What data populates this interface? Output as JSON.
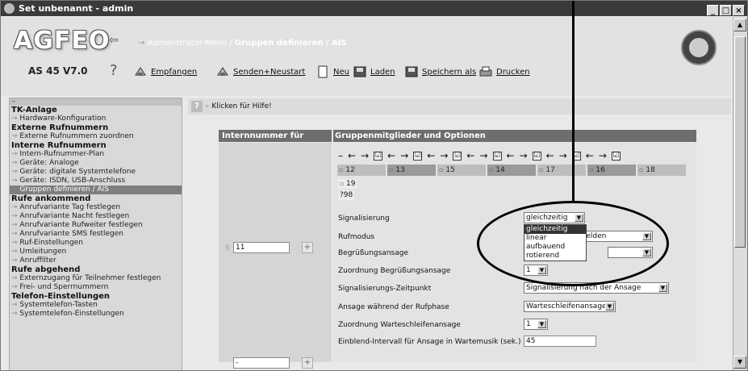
{
  "window": {
    "title": "Set unbenannt - admin",
    "controls": [
      "_",
      "□",
      "×"
    ]
  },
  "header": {
    "logo": "AGFEO",
    "breadcrumb_root": "Administrator-Menü",
    "breadcrumb_current": "Gruppen definieren / AIS",
    "version": "AS 45 V7.0",
    "help_mark": "?",
    "toolbar": [
      {
        "label": "Empfangen",
        "icon": "receive-icon"
      },
      {
        "label": "Senden+Neustart",
        "icon": "send-restart-icon"
      },
      {
        "label": "Neu",
        "icon": "new-document-icon"
      },
      {
        "label": "Laden",
        "icon": "load-icon"
      },
      {
        "label": "Speichern als",
        "icon": "save-as-icon"
      },
      {
        "label": "Drucken",
        "icon": "print-icon"
      }
    ]
  },
  "sidebar": {
    "collapse": "–",
    "items": [
      {
        "type": "section",
        "label": "TK-Anlage"
      },
      {
        "type": "item",
        "label": "Hardware-Konfiguration"
      },
      {
        "type": "section",
        "label": "Externe Rufnummern"
      },
      {
        "type": "item",
        "label": "Externe Rufnummern zuordnen"
      },
      {
        "type": "section",
        "label": "Interne Rufnummern"
      },
      {
        "type": "item",
        "label": "Intern-Rufnummer-Plan"
      },
      {
        "type": "item",
        "label": "Geräte: Analoge"
      },
      {
        "type": "item",
        "label": "Geräte: digitale Systemtelefone"
      },
      {
        "type": "item",
        "label": "Geräte: ISDN, USB-Anschluss"
      },
      {
        "type": "selected",
        "label": "Gruppen definieren / AIS"
      },
      {
        "type": "section",
        "label": "Rufe ankommend"
      },
      {
        "type": "item",
        "label": "Anrufvariante Tag festlegen"
      },
      {
        "type": "item",
        "label": "Anrufvariante Nacht festlegen"
      },
      {
        "type": "item",
        "label": "Anrufvariante Rufweiter festlegen"
      },
      {
        "type": "item",
        "label": "Anrufvariante SMS festlegen"
      },
      {
        "type": "item",
        "label": "Ruf-Einstellungen"
      },
      {
        "type": "item",
        "label": "Umleitungen"
      },
      {
        "type": "item",
        "label": "Anruffilter"
      },
      {
        "type": "section",
        "label": "Rufe abgehend"
      },
      {
        "type": "item",
        "label": "Externzugang für Teilnehmer festlegen"
      },
      {
        "type": "item",
        "label": "Frei- und Sperrnummern"
      },
      {
        "type": "section",
        "label": "Telefon-Einstellungen"
      },
      {
        "type": "item",
        "label": "Systemtelefon-Tasten"
      },
      {
        "type": "item",
        "label": "Systemtelefon-Einstellungen"
      }
    ]
  },
  "help": {
    "icon": "?",
    "text": "Klicken für Hilfe!"
  },
  "table": {
    "col1_header": "Internnummer für Gruppe",
    "col2_header": "Gruppenmitglieder und Optionen",
    "group_number": "11",
    "group_number_next": "-",
    "plus": "+",
    "arrow_controls": [
      "–",
      "←",
      "→",
      "☑",
      "←",
      "→",
      "☑",
      "←",
      "→",
      "☑",
      "←",
      "→",
      "☑",
      "←",
      "→",
      "☑",
      "←",
      "→",
      "☑",
      "←",
      "→",
      "☑"
    ],
    "members": [
      "12",
      "13",
      "15",
      "14",
      "17",
      "16",
      "18"
    ],
    "extra_members": [
      "19",
      "?98"
    ],
    "options": {
      "signalisierung": {
        "label": "Signalisierung",
        "value": "gleichzeitig"
      },
      "rufmodus": {
        "label": "Rufmodus",
        "value": "r Melden"
      },
      "begruessungsansage": {
        "label": "Begrüßungsansage",
        "value": ""
      },
      "zuordnung_begruessung": {
        "label": "Zuordnung Begrüßungsansage",
        "value": "1"
      },
      "signal_zeitpunkt": {
        "label": "Signalisierungs-Zeitpunkt",
        "value": "Signalisierung nach der Ansage"
      },
      "ansage_rufphase": {
        "label": "Ansage während der Rufphase",
        "value": "Warteschleifenansage"
      },
      "zuordnung_warteschleife": {
        "label": "Zuordnung Warteschleifenansage",
        "value": "1"
      },
      "einblend_intervall": {
        "label": "Einblend-Intervall für Ansage in Wartemusik (sek.)",
        "value": "45"
      }
    },
    "dropdown_options": [
      "gleichzeitig",
      "linear",
      "aufbauend",
      "rotierend"
    ]
  }
}
